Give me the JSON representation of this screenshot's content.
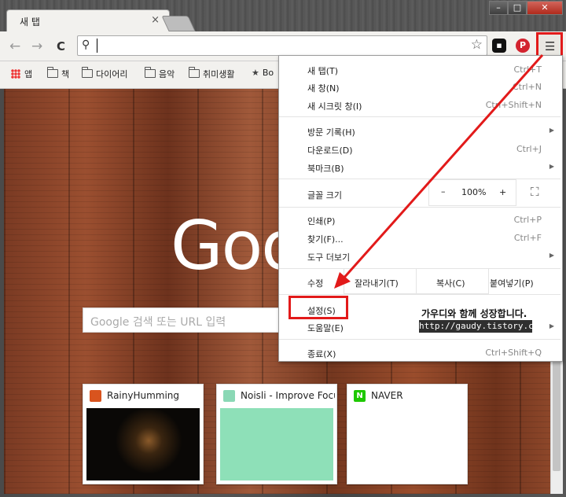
{
  "window": {
    "tab_title": "새 탭",
    "tab_close": "×",
    "controls": {
      "minimize": "–",
      "maximize": "□",
      "close": "✕"
    }
  },
  "toolbar": {
    "back": "←",
    "forward": "→",
    "reload": "C",
    "omnibox_value": "",
    "search_icon": "magnifier-icon",
    "star": "☆",
    "ext_blackberry": "▪",
    "ext_pinterest": "P",
    "menu_icon": "☰"
  },
  "bookmarks": [
    {
      "label": "앱",
      "icon": "apps-grid-icon"
    },
    {
      "label": "책",
      "icon": "folder-icon"
    },
    {
      "label": "다이어리",
      "icon": "folder-icon"
    },
    {
      "label": "음악",
      "icon": "folder-icon"
    },
    {
      "label": "취미생활",
      "icon": "folder-icon"
    },
    {
      "label": "Bo",
      "icon": "star-icon"
    }
  ],
  "newtab": {
    "logo": "Goog",
    "search_placeholder": "Google 검색 또는 URL 입력",
    "tiles": [
      {
        "title": "RainyHumming",
        "fav_color": "#d9541e"
      },
      {
        "title": "Noisli - Improve Focus",
        "fav_color": "#8ad8b5"
      },
      {
        "title": "NAVER",
        "fav_color": "#1ec800",
        "fav_text": "N"
      }
    ]
  },
  "menu": {
    "items": [
      {
        "label": "새 탭(T)",
        "shortcut": "Ctrl+T"
      },
      {
        "label": "새 창(N)",
        "shortcut": "Ctrl+N"
      },
      {
        "label": "새 시크릿 창(I)",
        "shortcut": "Ctrl+Shift+N"
      },
      {
        "label": "방문 기록(H)",
        "shortcut": ""
      },
      {
        "label": "다운로드(D)",
        "shortcut": "Ctrl+J"
      },
      {
        "label": "북마크(B)",
        "shortcut": ""
      },
      {
        "label": "인쇄(P)",
        "shortcut": "Ctrl+P"
      },
      {
        "label": "찾기(F)...",
        "shortcut": "Ctrl+F"
      },
      {
        "label": "도구 더보기",
        "shortcut": ""
      },
      {
        "label": "설정(S)",
        "shortcut": ""
      },
      {
        "label": "도움말(E)",
        "shortcut": ""
      },
      {
        "label": "종료(X)",
        "shortcut": "Ctrl+Shift+Q"
      }
    ],
    "zoom": {
      "label": "글꼴 크기",
      "minus": "–",
      "value": "100%",
      "plus": "+",
      "fullscreen": "⛶"
    },
    "edit": {
      "label": "수정",
      "cut": "잘라내기(T)",
      "copy": "복사(C)",
      "paste": "붙여넣기(P)"
    },
    "submenu_arrow": "▶"
  },
  "annotation": {
    "caption": "가우디와 함께 성장합니다.",
    "url": "http://gaudy.tistory.com",
    "color": "#e21a1a"
  }
}
